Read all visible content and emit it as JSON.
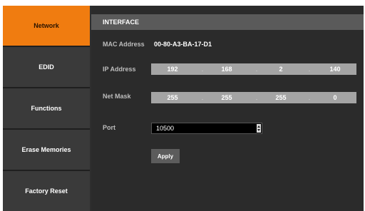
{
  "sidebar": {
    "items": [
      {
        "label": "Network",
        "active": true
      },
      {
        "label": "EDID",
        "active": false
      },
      {
        "label": "Functions",
        "active": false
      },
      {
        "label": "Erase Memories",
        "active": false
      },
      {
        "label": "Factory Reset",
        "active": false
      }
    ]
  },
  "interface": {
    "title": "INTERFACE",
    "mac_label": "MAC Address",
    "mac_value": "00-80-A3-BA-17-D1",
    "ip_label": "IP Address",
    "ip_octets": [
      "192",
      "168",
      "2",
      "140"
    ],
    "netmask_label": "Net Mask",
    "netmask_octets": [
      "255",
      "255",
      "255",
      "0"
    ],
    "port_label": "Port",
    "port_value": "10500",
    "apply_label": "Apply"
  },
  "colors": {
    "accent": "#f07c10",
    "panel": "#2b2b2b",
    "header": "#5a5a5a",
    "field": "#a4a4a4"
  }
}
